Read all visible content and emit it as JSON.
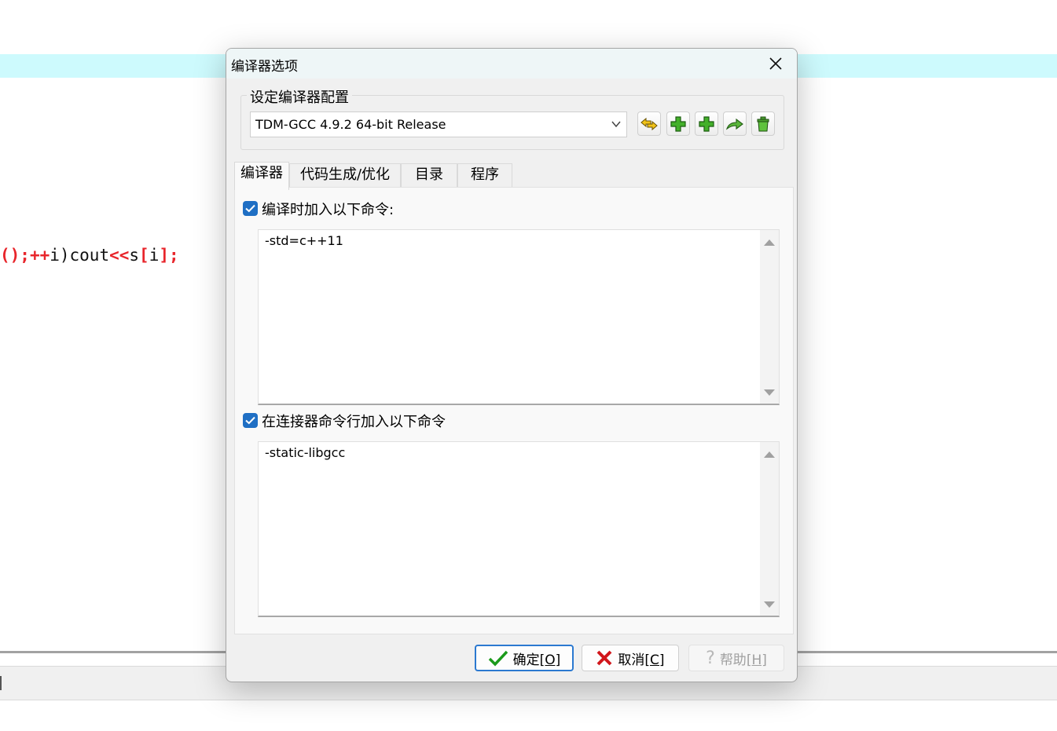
{
  "editor": {
    "code_line": {
      "p1": "();",
      "p2": "++",
      "p3": "i)cout",
      "p4": "<<",
      "p5": "s",
      "p6": "[",
      "p7": "i",
      "p8": "];"
    }
  },
  "dialog": {
    "title": "编译器选项",
    "config_group_label": "设定编译器配置",
    "compiler_selected": "TDM-GCC 4.9.2 64-bit Release",
    "toolbar_icons": [
      "swap-arrows-icon",
      "add-green-cross-icon",
      "add-green-cross-icon",
      "rename-arrow-icon",
      "trash-icon"
    ],
    "tabs": [
      {
        "label": "编译器",
        "active": true
      },
      {
        "label": "代码生成/优化",
        "active": false
      },
      {
        "label": "目录",
        "active": false
      },
      {
        "label": "程序",
        "active": false
      }
    ],
    "compile_commands": {
      "label": "编译时加入以下命令:",
      "checked": true,
      "value": "-std=c++11"
    },
    "linker_commands": {
      "label": "在连接器命令行加入以下命令",
      "checked": true,
      "value": "-static-libgcc"
    },
    "buttons": {
      "ok": {
        "label": "确定",
        "hotkey": "[O]"
      },
      "cancel": {
        "label": "取消",
        "hotkey": "[C]"
      },
      "help": {
        "label": "帮助",
        "hotkey": "[H]"
      }
    }
  },
  "colors": {
    "editor_line_highlight": "#cdfafd",
    "code_operator": "#e8252b",
    "accent": "#2b79d0",
    "checkbox": "#1f6fc4"
  }
}
